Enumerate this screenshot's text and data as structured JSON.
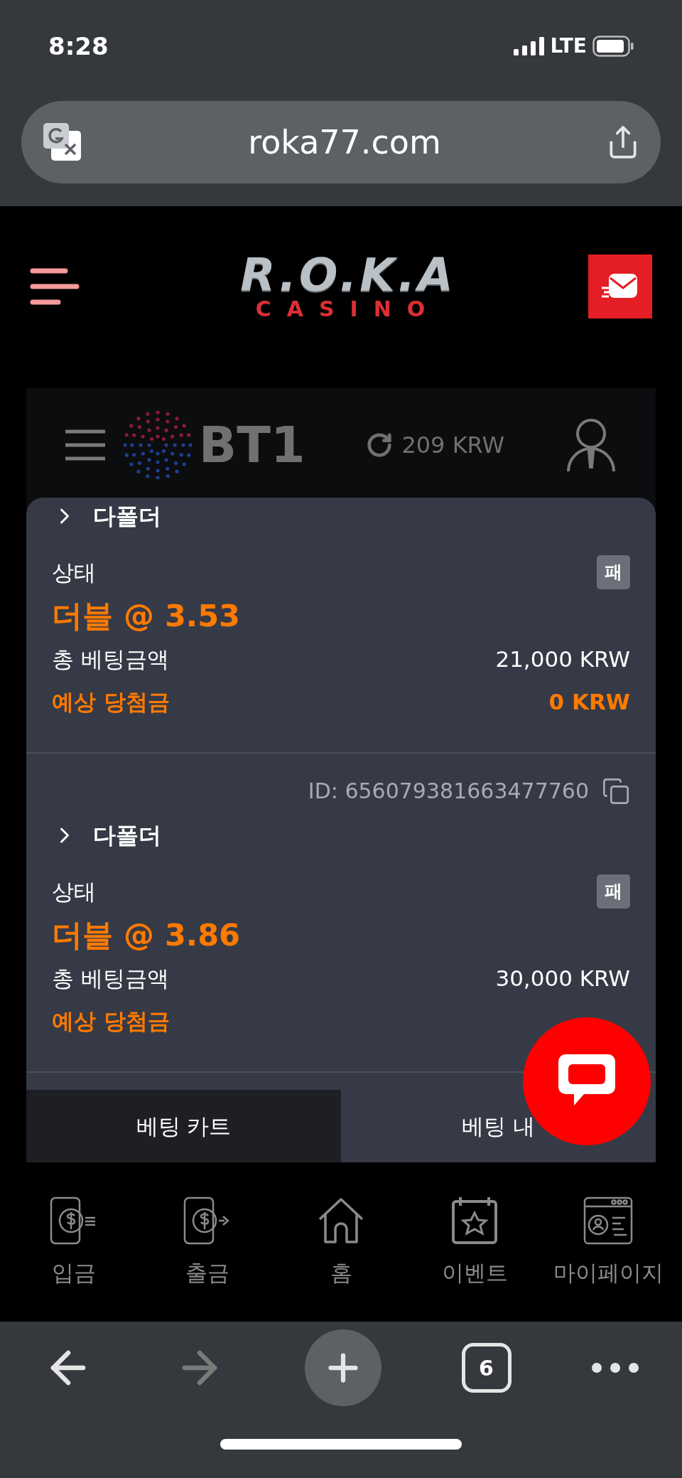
{
  "status_bar": {
    "time": "8:28",
    "network": "LTE"
  },
  "browser": {
    "url": "roka77.com",
    "tab_count": "6"
  },
  "site_header": {
    "logo_top": "R.O.K.A",
    "logo_bottom": "CASINO"
  },
  "sportsbook_bar": {
    "logo": "BT1",
    "balance": "209 KRW"
  },
  "bets": [
    {
      "type": "다폴더",
      "status_label": "상태",
      "result_badge": "패",
      "odds_line": "더블 @ 3.53",
      "stake_label": "총 베팅금액",
      "stake": "21,000 KRW",
      "payout_label": "예상 당첨금",
      "payout": "0 KRW"
    },
    {
      "id": "ID: 656079381663477760",
      "type": "다폴더",
      "status_label": "상태",
      "result_badge": "패",
      "odds_line": "더블 @ 3.86",
      "stake_label": "총 베팅금액",
      "stake": "30,000 KRW",
      "payout_label": "예상 당첨금"
    }
  ],
  "bet_tabs": [
    {
      "label": "베팅 카트",
      "selected": false
    },
    {
      "label": "베팅 내",
      "selected": true
    }
  ],
  "bottom_nav": [
    {
      "label": "입금",
      "kind": "deposit"
    },
    {
      "label": "출금",
      "kind": "withdraw"
    },
    {
      "label": "홈",
      "kind": "home"
    },
    {
      "label": "이벤트",
      "kind": "event"
    },
    {
      "label": "마이페이지",
      "kind": "mypage"
    }
  ]
}
